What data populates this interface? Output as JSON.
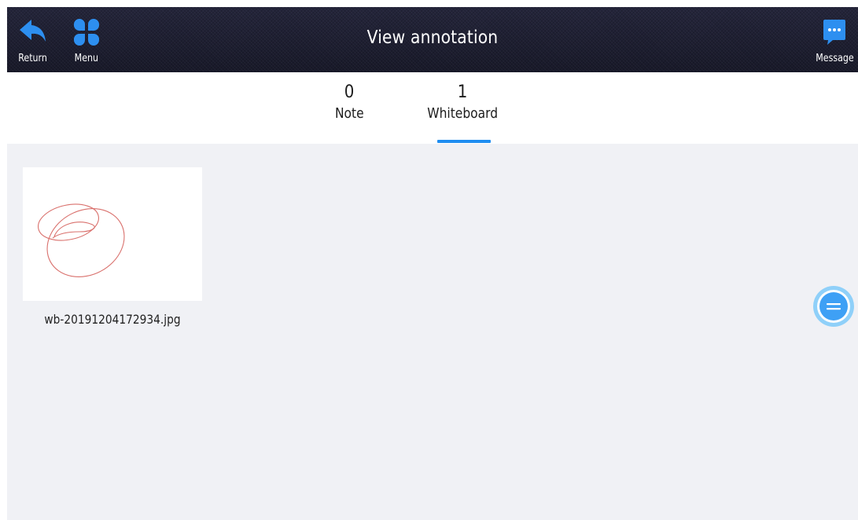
{
  "header": {
    "title": "View annotation",
    "return_label": "Return",
    "menu_label": "Menu",
    "message_label": "Message"
  },
  "tabs": [
    {
      "count": "0",
      "label": "Note",
      "selected": false
    },
    {
      "count": "1",
      "label": "Whiteboard",
      "selected": true
    }
  ],
  "files": [
    {
      "filename": "wb-20191204172934.jpg",
      "thumbnail": "red-scribble-ellipses"
    }
  ],
  "icons": {
    "return": "return-arrow-icon",
    "menu": "four-petal-menu-icon",
    "message": "chat-bubble-icon",
    "fab": "floating-menu-icon"
  },
  "colors": {
    "accent": "#1f8ef1",
    "header_bg": "#1d1e32",
    "content_bg": "#f0f1f5",
    "scribble": "#d9706c"
  }
}
